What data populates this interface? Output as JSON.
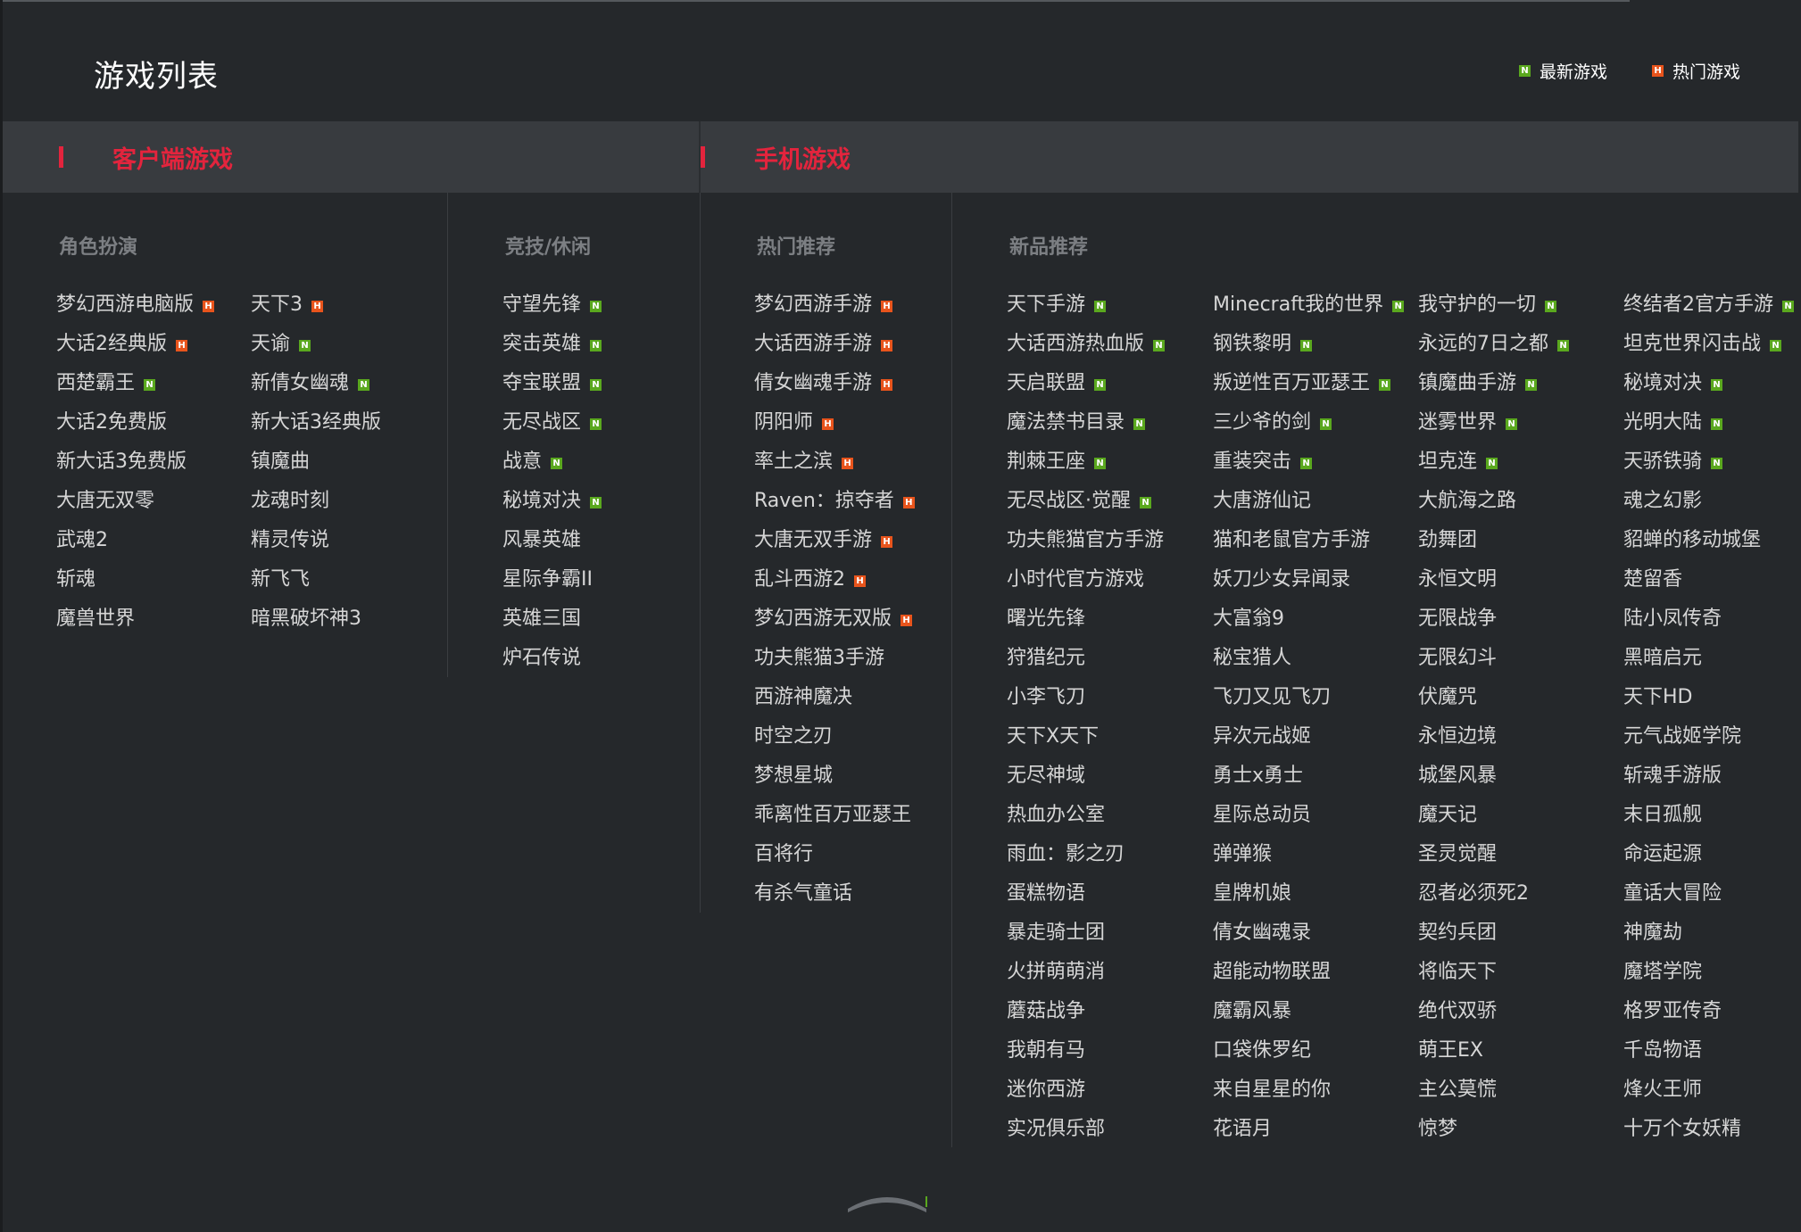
{
  "page_title": "游戏列表",
  "legend": {
    "newest_label": "最新游戏",
    "hot_label": "热门游戏"
  },
  "colors": {
    "accent": "#e3243d",
    "badge_new": "#5aa81e",
    "badge_hot": "#e8541c",
    "background": "#25282b"
  },
  "badge_letters": {
    "new": "N",
    "hot": "H"
  },
  "sections": {
    "client": "客户端游戏",
    "mobile": "手机游戏"
  },
  "client": {
    "roleplay": {
      "heading": "角色扮演",
      "col1": [
        {
          "name": "梦幻西游电脑版",
          "badge": "hot"
        },
        {
          "name": "大话2经典版",
          "badge": "hot"
        },
        {
          "name": "西楚霸王",
          "badge": "new"
        },
        {
          "name": "大话2免费版",
          "badge": ""
        },
        {
          "name": "新大话3免费版",
          "badge": ""
        },
        {
          "name": "大唐无双零",
          "badge": ""
        },
        {
          "name": "武魂2",
          "badge": ""
        },
        {
          "name": "斩魂",
          "badge": ""
        },
        {
          "name": "魔兽世界",
          "badge": ""
        }
      ],
      "col2": [
        {
          "name": "天下3",
          "badge": "hot"
        },
        {
          "name": "天谕",
          "badge": "new"
        },
        {
          "name": "新倩女幽魂",
          "badge": "new"
        },
        {
          "name": "新大话3经典版",
          "badge": ""
        },
        {
          "name": "镇魔曲",
          "badge": ""
        },
        {
          "name": "龙魂时刻",
          "badge": ""
        },
        {
          "name": "精灵传说",
          "badge": ""
        },
        {
          "name": "新飞飞",
          "badge": ""
        },
        {
          "name": "暗黑破坏神3",
          "badge": ""
        }
      ]
    },
    "competitive": {
      "heading": "竞技/休闲",
      "col1": [
        {
          "name": "守望先锋",
          "badge": "new"
        },
        {
          "name": "突击英雄",
          "badge": "new"
        },
        {
          "name": "夺宝联盟",
          "badge": "new"
        },
        {
          "name": "无尽战区",
          "badge": "new"
        },
        {
          "name": "战意",
          "badge": "new"
        },
        {
          "name": "秘境对决",
          "badge": "new"
        },
        {
          "name": "风暴英雄",
          "badge": ""
        },
        {
          "name": "星际争霸II",
          "badge": ""
        },
        {
          "name": "英雄三国",
          "badge": ""
        },
        {
          "name": "炉石传说",
          "badge": ""
        }
      ]
    }
  },
  "mobile": {
    "hot": {
      "heading": "热门推荐",
      "col1": [
        {
          "name": "梦幻西游手游",
          "badge": "hot"
        },
        {
          "name": "大话西游手游",
          "badge": "hot"
        },
        {
          "name": "倩女幽魂手游",
          "badge": "hot"
        },
        {
          "name": "阴阳师",
          "badge": "hot"
        },
        {
          "name": "率土之滨",
          "badge": "hot"
        },
        {
          "name": "Raven：掠夺者",
          "badge": "hot"
        },
        {
          "name": "大唐无双手游",
          "badge": "hot"
        },
        {
          "name": "乱斗西游2",
          "badge": "hot"
        },
        {
          "name": "梦幻西游无双版",
          "badge": "hot"
        },
        {
          "name": "功夫熊猫3手游",
          "badge": ""
        },
        {
          "name": "西游神魔决",
          "badge": ""
        },
        {
          "name": "时空之刃",
          "badge": ""
        },
        {
          "name": "梦想星城",
          "badge": ""
        },
        {
          "name": "乖离性百万亚瑟王",
          "badge": ""
        },
        {
          "name": "百将行",
          "badge": ""
        },
        {
          "name": "有杀气童话",
          "badge": ""
        }
      ]
    },
    "new": {
      "heading": "新品推荐",
      "col1": [
        {
          "name": "天下手游",
          "badge": "new"
        },
        {
          "name": "大话西游热血版",
          "badge": "new"
        },
        {
          "name": "天启联盟",
          "badge": "new"
        },
        {
          "name": "魔法禁书目录",
          "badge": "new"
        },
        {
          "name": "荆棘王座",
          "badge": "new"
        },
        {
          "name": "无尽战区·觉醒",
          "badge": "new"
        },
        {
          "name": "功夫熊猫官方手游",
          "badge": ""
        },
        {
          "name": "小时代官方游戏",
          "badge": ""
        },
        {
          "name": "曙光先锋",
          "badge": ""
        },
        {
          "name": "狩猎纪元",
          "badge": ""
        },
        {
          "name": "小李飞刀",
          "badge": ""
        },
        {
          "name": "天下X天下",
          "badge": ""
        },
        {
          "name": "无尽神域",
          "badge": ""
        },
        {
          "name": "热血办公室",
          "badge": ""
        },
        {
          "name": "雨血：影之刃",
          "badge": ""
        },
        {
          "name": "蛋糕物语",
          "badge": ""
        },
        {
          "name": "暴走骑士团",
          "badge": ""
        },
        {
          "name": "火拼萌萌消",
          "badge": ""
        },
        {
          "name": "蘑菇战争",
          "badge": ""
        },
        {
          "name": "我朝有马",
          "badge": ""
        },
        {
          "name": "迷你西游",
          "badge": ""
        },
        {
          "name": "实况俱乐部",
          "badge": ""
        }
      ],
      "col2": [
        {
          "name": "Minecraft我的世界",
          "badge": "new"
        },
        {
          "name": "钢铁黎明",
          "badge": "new"
        },
        {
          "name": "叛逆性百万亚瑟王",
          "badge": "new"
        },
        {
          "name": "三少爷的剑",
          "badge": "new"
        },
        {
          "name": "重装突击",
          "badge": "new"
        },
        {
          "name": "大唐游仙记",
          "badge": ""
        },
        {
          "name": "猫和老鼠官方手游",
          "badge": ""
        },
        {
          "name": "妖刀少女异闻录",
          "badge": ""
        },
        {
          "name": "大富翁9",
          "badge": ""
        },
        {
          "name": "秘宝猎人",
          "badge": ""
        },
        {
          "name": "飞刀又见飞刀",
          "badge": ""
        },
        {
          "name": "异次元战姬",
          "badge": ""
        },
        {
          "name": "勇士x勇士",
          "badge": ""
        },
        {
          "name": "星际总动员",
          "badge": ""
        },
        {
          "name": "弹弹猴",
          "badge": ""
        },
        {
          "name": "皇牌机娘",
          "badge": ""
        },
        {
          "name": "倩女幽魂录",
          "badge": ""
        },
        {
          "name": "超能动物联盟",
          "badge": ""
        },
        {
          "name": "魔霸风暴",
          "badge": ""
        },
        {
          "name": "口袋侏罗纪",
          "badge": ""
        },
        {
          "name": "来自星星的你",
          "badge": ""
        },
        {
          "name": "花语月",
          "badge": ""
        }
      ],
      "col3": [
        {
          "name": "我守护的一切",
          "badge": "new"
        },
        {
          "name": "永远的7日之都",
          "badge": "new"
        },
        {
          "name": "镇魔曲手游",
          "badge": "new"
        },
        {
          "name": "迷雾世界",
          "badge": "new"
        },
        {
          "name": "坦克连",
          "badge": "new"
        },
        {
          "name": "大航海之路",
          "badge": ""
        },
        {
          "name": "劲舞团",
          "badge": ""
        },
        {
          "name": "永恒文明",
          "badge": ""
        },
        {
          "name": "无限战争",
          "badge": ""
        },
        {
          "name": "无限幻斗",
          "badge": ""
        },
        {
          "name": "伏魔咒",
          "badge": ""
        },
        {
          "name": "永恒边境",
          "badge": ""
        },
        {
          "name": "城堡风暴",
          "badge": ""
        },
        {
          "name": "魔天记",
          "badge": ""
        },
        {
          "name": "圣灵觉醒",
          "badge": ""
        },
        {
          "name": "忍者必须死2",
          "badge": ""
        },
        {
          "name": "契约兵团",
          "badge": ""
        },
        {
          "name": "将临天下",
          "badge": ""
        },
        {
          "name": "绝代双骄",
          "badge": ""
        },
        {
          "name": "萌王EX",
          "badge": ""
        },
        {
          "name": "主公莫慌",
          "badge": ""
        },
        {
          "name": "惊梦",
          "badge": ""
        }
      ],
      "col4": [
        {
          "name": "终结者2官方手游",
          "badge": "new"
        },
        {
          "name": "坦克世界闪击战",
          "badge": "new"
        },
        {
          "name": "秘境对决",
          "badge": "new"
        },
        {
          "name": "光明大陆",
          "badge": "new"
        },
        {
          "name": "天骄铁骑",
          "badge": "new"
        },
        {
          "name": "魂之幻影",
          "badge": ""
        },
        {
          "name": "貂蝉的移动城堡",
          "badge": ""
        },
        {
          "name": "楚留香",
          "badge": ""
        },
        {
          "name": "陆小凤传奇",
          "badge": ""
        },
        {
          "name": "黑暗启元",
          "badge": ""
        },
        {
          "name": "天下HD",
          "badge": ""
        },
        {
          "name": "元气战姬学院",
          "badge": ""
        },
        {
          "name": "斩魂手游版",
          "badge": ""
        },
        {
          "name": "末日孤舰",
          "badge": ""
        },
        {
          "name": "命运起源",
          "badge": ""
        },
        {
          "name": "童话大冒险",
          "badge": ""
        },
        {
          "name": "神魔劫",
          "badge": ""
        },
        {
          "name": "魔塔学院",
          "badge": ""
        },
        {
          "name": "格罗亚传奇",
          "badge": ""
        },
        {
          "name": "千岛物语",
          "badge": ""
        },
        {
          "name": "烽火王师",
          "badge": ""
        },
        {
          "name": "十万个女妖精",
          "badge": ""
        }
      ]
    }
  },
  "collapse_icon": "chevron-up-icon"
}
